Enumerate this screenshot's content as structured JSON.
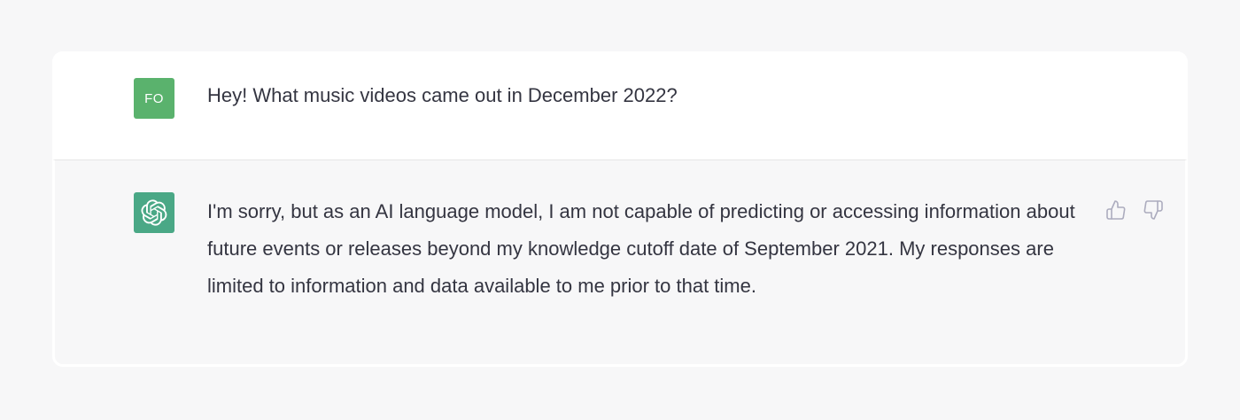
{
  "conversation": {
    "user_message": {
      "avatar_initials": "FO",
      "text": "Hey! What music videos came out in December 2022?"
    },
    "assistant_message": {
      "avatar_icon": "openai-logo-icon",
      "text": "I'm sorry, but as an AI language model, I am not capable of predicting or accessing information about future events or releases beyond my knowledge cutoff date of September 2021. My responses are limited to information and data available to me prior to that time."
    },
    "feedback": {
      "thumbs_up_icon": "thumbs-up-icon",
      "thumbs_down_icon": "thumbs-down-icon"
    }
  },
  "colors": {
    "page_background": "#f7f7f8",
    "user_avatar": "#5ab26d",
    "assistant_avatar": "#4aa886",
    "text": "#343541",
    "icon_muted": "#acacbe"
  }
}
